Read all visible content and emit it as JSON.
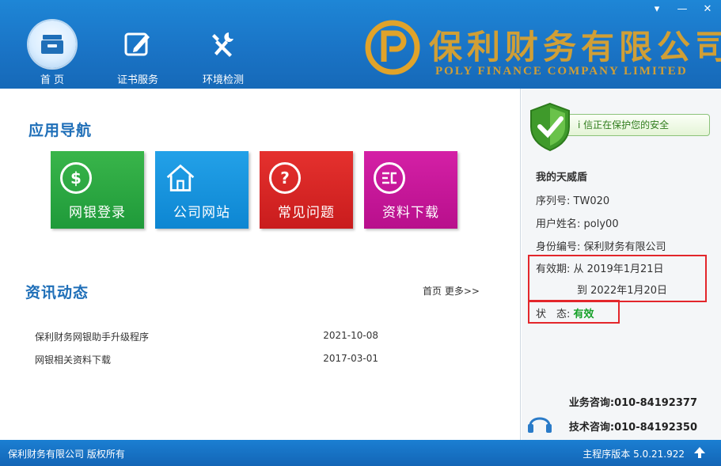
{
  "header": {
    "nav": [
      {
        "label": "首 页",
        "icon": "home-drawer-icon",
        "active": true
      },
      {
        "label": "证书服务",
        "icon": "certificate-edit-icon",
        "active": false
      },
      {
        "label": "环境检测",
        "icon": "tools-icon",
        "active": false
      }
    ],
    "logo": {
      "cn": "保利财务有限公司",
      "en": "POLY FINANCE COMPANY LIMITED",
      "letter": "P"
    },
    "window": {
      "menu": "▾",
      "minimize": "—",
      "close": "✕"
    }
  },
  "main": {
    "nav_title": "应用导航",
    "tiles": [
      {
        "label": "网银登录",
        "icon": "dollar-icon",
        "color": "#1f9a3a"
      },
      {
        "label": "公司网站",
        "icon": "house-icon",
        "color": "#0d86d2"
      },
      {
        "label": "常见问题",
        "icon": "question-icon",
        "color": "#c91c1d"
      },
      {
        "label": "资料下载",
        "icon": "document-icon",
        "color": "#b80f8c"
      }
    ],
    "news_title": "资讯动态",
    "more": {
      "home": "首页",
      "more": "更多>>"
    },
    "news": [
      {
        "title": "保利财务网银助手升级程序",
        "date": "2021-10-08"
      },
      {
        "title": "网银相关资料下载",
        "date": "2017-03-01"
      }
    ]
  },
  "side": {
    "safe_text": "信正在保护您的安全",
    "safe_prefix": "i",
    "shield_title": "我的天威盾",
    "serial_label": "序列号:",
    "serial_value": "TW020",
    "username_label": "用户姓名:",
    "username_value": "poly00",
    "id_label": "身份编号:",
    "id_value": "保利财务有限公司",
    "valid_label": "有效期:",
    "valid_from": "从 2019年1月21日",
    "valid_to": "到 2022年1月20日",
    "status_label": "状　态:",
    "status_value": "有效",
    "biz_phone": "业务咨询:010-84192377",
    "tech_phone": "技术咨询:010-84192350"
  },
  "footer": {
    "copyright": "保利财务有限公司 版权所有",
    "version": "主程序版本 5.0.21.922"
  },
  "colors": {
    "header": "#1a74c6",
    "logo_gold": "#e0a32a",
    "alert_red": "#e3262b",
    "status_green": "#17a12a"
  }
}
